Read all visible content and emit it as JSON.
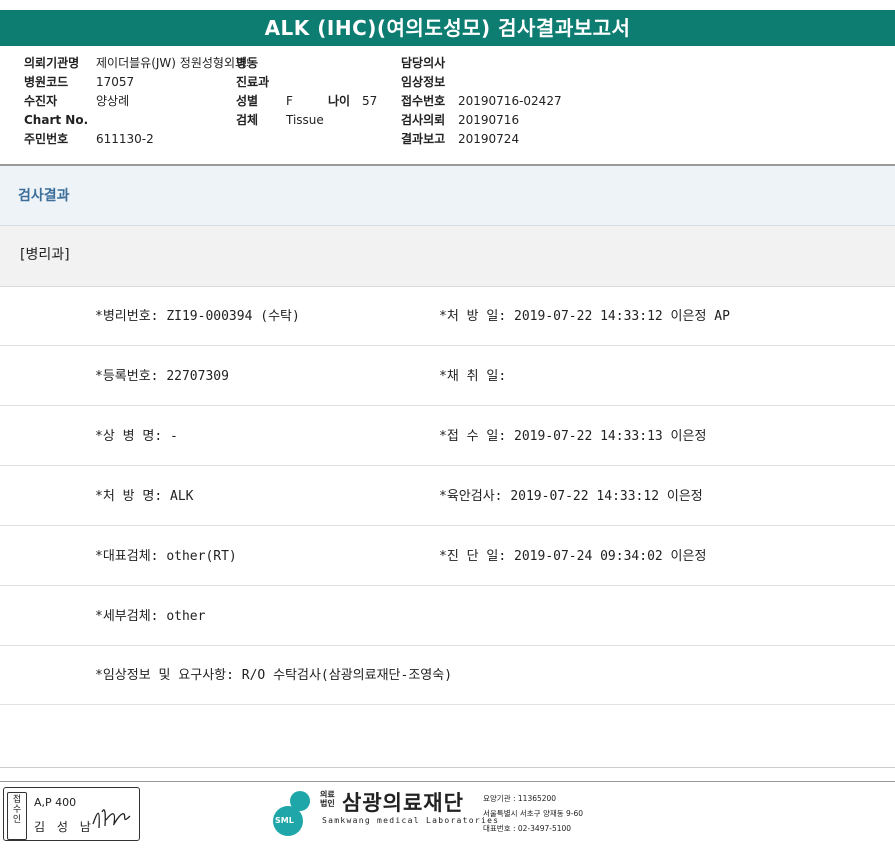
{
  "title": "ALK (IHC)(여의도성모) 검사결과보고서",
  "header": {
    "col1": [
      {
        "label": "의뢰기관명",
        "value": "제이더블유(JW) 정원성형외과의원"
      },
      {
        "label": "병원코드",
        "value": "17057"
      },
      {
        "label": "수진자",
        "value": "양상례"
      },
      {
        "label": "Chart No.",
        "value": ""
      },
      {
        "label": "주민번호",
        "value": "611130-2"
      }
    ],
    "col2": [
      {
        "label": "병동",
        "value": ""
      },
      {
        "label": "진료과",
        "value": ""
      },
      {
        "label": "성별",
        "value": "F"
      },
      {
        "label": "검체",
        "value": "Tissue"
      }
    ],
    "age": {
      "label": "나이",
      "value": "57"
    },
    "col3": [
      {
        "label": "담당의사",
        "value": ""
      },
      {
        "label": "임상정보",
        "value": ""
      },
      {
        "label": "접수번호",
        "value": "20190716-02427"
      },
      {
        "label": "검사의뢰",
        "value": "20190716"
      },
      {
        "label": "결과보고",
        "value": "20190724"
      }
    ]
  },
  "sections": {
    "results": "검사결과",
    "pathology": "[병리과]"
  },
  "rows": [
    {
      "left": "*병리번호: ZI19-000394 (수탁)",
      "right": "*처 방 일: 2019-07-22 14:33:12  이은정 AP"
    },
    {
      "left": "*등록번호: 22707309",
      "right": "*채 취 일:"
    },
    {
      "left": "*상 병 명: -",
      "right": "*접 수 일: 2019-07-22 14:33:13  이은정"
    },
    {
      "left": "*처 방 명: ALK",
      "right": "*육안검사: 2019-07-22 14:33:12  이은정"
    },
    {
      "left": "*대표검체: other(RT)",
      "right": "*진 단 일: 2019-07-24 09:34:02  이은정"
    },
    {
      "left": "*세부검체: other",
      "right": ""
    },
    {
      "left": "*임상정보 및 요구사항: R/O 수탁검사(삼광의료재단-조영숙)",
      "right": ""
    }
  ],
  "footer": {
    "stamp_label": "접수인",
    "stamp_line1": "A,P 400",
    "stamp_line2": "김 성 남",
    "org_small_1": "의료",
    "org_small_2": "법인",
    "org_name": "삼광의료재단",
    "org_eng": "Samkwang medical Laboratories",
    "logo_badge": "SML",
    "contact_1": "요양기관 : 11365200",
    "contact_2": "서울특별시 서초구 양재동 9-60",
    "contact_3": "대표번호 : 02-3497-5100"
  },
  "colors": {
    "title_bg": "#0d7d72",
    "section_text": "#3c6e9a",
    "logo_teal": "#1fa6a8"
  }
}
